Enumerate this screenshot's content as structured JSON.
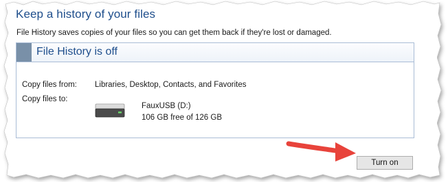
{
  "header": {
    "title": "Keep a history of your files",
    "description": "File History saves copies of your files so you can get them back if they're lost or damaged."
  },
  "status": {
    "title": "File History is off",
    "copy_from_label": "Copy files from:",
    "copy_from_value": "Libraries, Desktop, Contacts, and Favorites",
    "copy_to_label": "Copy files to:"
  },
  "drive": {
    "name": "FauxUSB (D:)",
    "free_space": "106 GB free of 126 GB",
    "icon": "drive-icon"
  },
  "actions": {
    "turn_on_label": "Turn on"
  },
  "colors": {
    "heading_blue": "#1e4e8c",
    "border_blue": "#a9bcd6",
    "accent_gray": "#7990a8",
    "arrow_red": "#e8433b"
  }
}
